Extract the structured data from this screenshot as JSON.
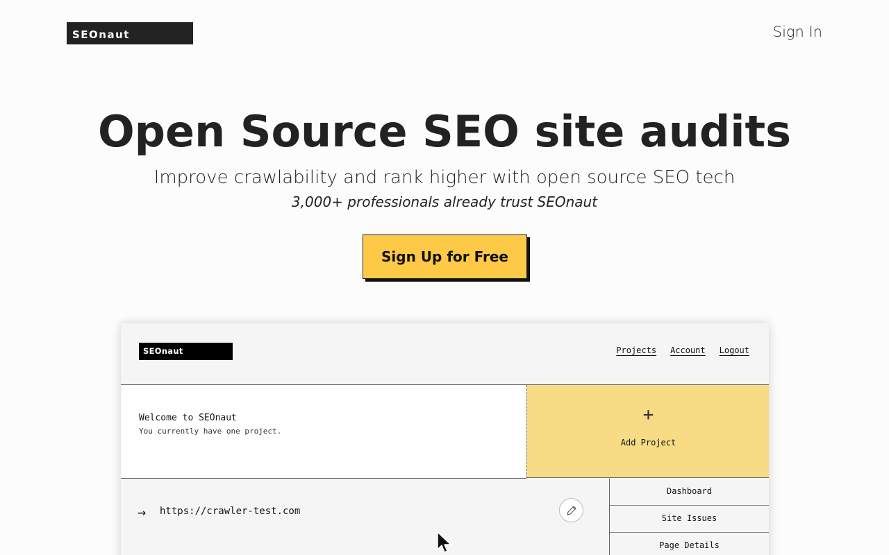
{
  "header": {
    "logo_text": "SEOnaut",
    "signin_label": "Sign In"
  },
  "hero": {
    "title": "Open Source SEO site audits",
    "subtitle": "Improve crawlability and rank higher with open source SEO tech",
    "trust": "3,000+ professionals already trust SEOnaut",
    "cta_label": "Sign Up for Free"
  },
  "mock": {
    "logo_text": "SEOnaut",
    "nav": [
      "Projects",
      "Account",
      "Logout"
    ],
    "welcome_title": "Welcome to SEOnaut",
    "welcome_sub": "You currently have one project.",
    "add_icon": "+",
    "add_label": "Add Project",
    "project_arrow": "→",
    "project_url": "https://crawler-test.com",
    "menu": [
      "Dashboard",
      "Site Issues",
      "Page Details"
    ]
  },
  "colors": {
    "accent_yellow": "#fec946",
    "mock_yellow": "#f7dc85",
    "dark": "#222222"
  },
  "icons": {
    "edit": "pencil-icon",
    "cursor": "mouse-pointer-icon",
    "arrow": "arrow-right-icon",
    "plus": "plus-icon"
  }
}
